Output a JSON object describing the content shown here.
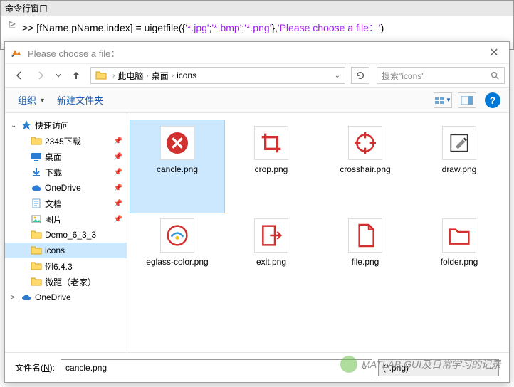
{
  "cmdwin": {
    "title": "命令行窗口",
    "prompt": ">> ",
    "code_lhs": "[fName,pName,index] = uigetfile({",
    "code_str1": "'*.jpg'",
    "code_sep1": ";",
    "code_str2": "'*.bmp'",
    "code_sep2": ";",
    "code_str3": "'*.png'",
    "code_rhs1": "},",
    "code_prompt_str": "'Please choose a file：'",
    "code_rhs2": ")"
  },
  "dialog": {
    "title": "Please choose a file：",
    "close": "✕",
    "breadcrumb": [
      "此电脑",
      "桌面",
      "icons"
    ],
    "search_placeholder": "搜索\"icons\"",
    "toolbar": {
      "organize": "组织",
      "new_folder": "新建文件夹"
    },
    "tree": [
      {
        "label": "快速访问",
        "expanded": true,
        "icon": "star",
        "color": "#2b7cd3"
      },
      {
        "label": "2345下载",
        "depth": 1,
        "pinned": true,
        "icon": "folder"
      },
      {
        "label": "桌面",
        "depth": 1,
        "pinned": true,
        "icon": "desktop",
        "color": "#2b7cd3"
      },
      {
        "label": "下载",
        "depth": 1,
        "pinned": true,
        "icon": "download",
        "color": "#2b7cd3"
      },
      {
        "label": "OneDrive",
        "depth": 1,
        "pinned": true,
        "icon": "cloud",
        "color": "#2b7cd3"
      },
      {
        "label": "文档",
        "depth": 1,
        "pinned": true,
        "icon": "doc",
        "color": "#6aa6d6"
      },
      {
        "label": "图片",
        "depth": 1,
        "pinned": true,
        "icon": "pic",
        "color": "#3c9"
      },
      {
        "label": "Demo_6_3_3",
        "depth": 1,
        "icon": "folder"
      },
      {
        "label": "icons",
        "depth": 1,
        "selected": true,
        "icon": "folder"
      },
      {
        "label": "例6.4.3",
        "depth": 1,
        "icon": "folder"
      },
      {
        "label": "微距（老家）",
        "depth": 1,
        "icon": "folder"
      },
      {
        "label": "OneDrive",
        "icon": "cloud",
        "color": "#2b7cd3",
        "arrow": ">"
      }
    ],
    "files": [
      {
        "name": "cancle.png",
        "icon": "cancle",
        "selected": true
      },
      {
        "name": "crop.png",
        "icon": "crop"
      },
      {
        "name": "crosshair.png",
        "icon": "crosshair"
      },
      {
        "name": "draw.png",
        "icon": "draw"
      },
      {
        "name": "eglass-color.png",
        "icon": "eglass"
      },
      {
        "name": "exit.png",
        "icon": "exit"
      },
      {
        "name": "file.png",
        "icon": "file"
      },
      {
        "name": "folder.png",
        "icon": "folder-outline"
      }
    ],
    "filename_label_pre": "文件名(",
    "filename_label_u": "N",
    "filename_label_post": "):",
    "filename_value": "cancle.png",
    "filter_value": "(*.png)"
  },
  "watermark": "MATLAB GUI及日常学习的记录"
}
